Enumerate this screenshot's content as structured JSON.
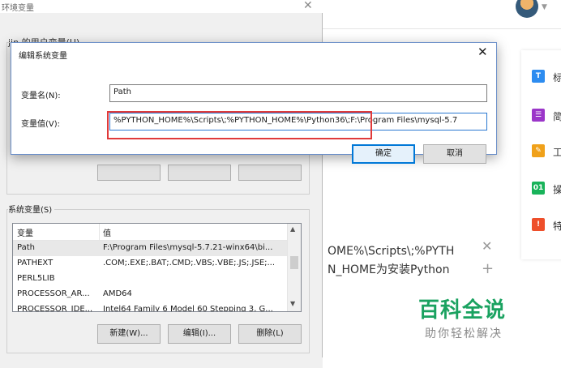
{
  "background": {
    "sidebar_items": [
      {
        "glyph": "T",
        "text": "标",
        "color": "#2d8cf0"
      },
      {
        "glyph": "☰",
        "text": "简",
        "color": "#9b36c9"
      },
      {
        "glyph": "✎",
        "text": "工",
        "color": "#f0a11a"
      },
      {
        "glyph": "01",
        "text": "操",
        "color": "#19b35a"
      },
      {
        "glyph": "!",
        "text": "特",
        "color": "#ee4f2b"
      }
    ],
    "content_line1": "OME%\\Scripts\\;%PYTH",
    "content_line2": "N_HOME为安装Python",
    "logo_main": "百科全说",
    "logo_sub": "助你轻松解决"
  },
  "env_dialog": {
    "title": "环境变量",
    "user_vars_label": "jin 的用户变量(U)",
    "system_vars_label": "系统变量(S)",
    "columns": [
      "变量",
      "值"
    ],
    "rows": [
      {
        "name": "Path",
        "value": "F:\\Program Files\\mysql-5.7.21-winx64\\bi...",
        "selected": true
      },
      {
        "name": "PATHEXT",
        "value": ".COM;.EXE;.BAT;.CMD;.VBS;.VBE;.JS;.JSE;..."
      },
      {
        "name": "PERL5LIB",
        "value": ""
      },
      {
        "name": "PROCESSOR_AR...",
        "value": "AMD64"
      },
      {
        "name": "PROCESSOR_IDE...",
        "value": "Intel64 Family 6 Model 60 Stepping 3, G..."
      }
    ],
    "buttons": {
      "new": "新建(W)...",
      "edit": "编辑(I)...",
      "delete": "删除(L)"
    }
  },
  "edit_dialog": {
    "title": "编辑系统变量",
    "name_label": "变量名(N):",
    "name_value": "Path",
    "value_label": "变量值(V):",
    "value_value": "%PYTHON_HOME%\\Scripts\\;%PYTHON_HOME%\\Python36\\;F:\\Program Files\\mysql-5.7",
    "ok": "确定",
    "cancel": "取消"
  }
}
